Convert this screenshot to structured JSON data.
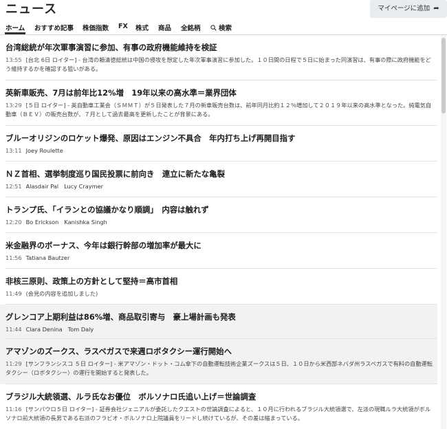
{
  "header": {
    "title": "ニュース",
    "mypage_button": "マイページに追加",
    "mypage_icon": "share-arrow-icon"
  },
  "nav": {
    "tabs": [
      {
        "label": "ホーム",
        "active": true
      },
      {
        "label": "おすすめ記事"
      },
      {
        "label": "株価指数"
      },
      {
        "label": "FX"
      },
      {
        "label": "株式"
      },
      {
        "label": "商品"
      },
      {
        "label": "全銘柄"
      },
      {
        "label": "検索",
        "icon": "search-icon"
      }
    ]
  },
  "articles": [
    {
      "headline": "台湾総統が年次軍事演習に参加、有事の政府機能維持を検証",
      "time": "13:55",
      "summary": "[台北 6日 ロイター] - 台湾の頼清徳総統は中国の侵攻を想定した年次軍事演習に参加した。１０日間の日程で５日に始まった同演習は、有事の際に政府機能をどう維持するかを確認する狙いがある。"
    },
    {
      "headline": "英新車販売、7月は前年比12%増　19年以来の高水準＝業界団体",
      "time": "13:29",
      "summary": "[５日 ロイター] - 英自動車工業会（ＳＭＭＴ）が５日発表した７月の新車販売台数は、前年同月比約１２％増加して２０１９年以来の高水準となった。純電気自動車（ＢＥＶ）の販売台数が、７月として過去最高を更新したことが背景にある。"
    },
    {
      "headline": "ブルーオリジンのロケット爆発、原因はエンジン不具合　年内打ち上げ再開目指す",
      "time": "13:11",
      "authors": [
        "Joey Roulette"
      ]
    },
    {
      "headline": "ＮＺ首相、選挙制度巡り国民投票に前向き　連立に新たな亀裂",
      "time": "12:51",
      "authors": [
        "Alasdair Pal",
        "Lucy Craymer"
      ]
    },
    {
      "headline": "トランプ氏、「イランとの協議かなり順調」　内容は触れず",
      "time": "12:20",
      "authors": [
        "Bo Erickson",
        "Kanishka Singh"
      ]
    },
    {
      "headline": "米金融界のボーナス、今年は銀行幹部の増加率が最大に",
      "time": "11:56",
      "authors": [
        "Tatiana Bautzer"
      ]
    },
    {
      "headline": "非核三原則、政策上の方針として堅持＝高市首相",
      "time": "11:49",
      "summary": "(会見の内容を追加しました)"
    },
    {
      "headline": "グレンコア上期利益は86%増、商品取引寄与　豪上場計画も発表",
      "time": "11:44",
      "authors": [
        "Clara Denina",
        "Tom Daly"
      ],
      "shaded": true
    },
    {
      "headline": "アマゾンのズークス、ラスベガスで来週ロボタクシー運行開始へ",
      "time": "11:29",
      "summary": "[サンフランシスコ ５日 ロイター] - 米アマゾン・ドット・コム傘下の自動運転技術企業ズークスは５日、１０日から米西部ネバダ州ラスベガスで有料の自動運転タクシー（ロボタクシー）の運行を開始すると発表した。",
      "shaded": true
    },
    {
      "headline": "ブラジル大統領選、ルラ氏なお優位　ボルソナロ氏追い上げ＝世論調査",
      "time": "11:16",
      "summary": "[サンパウロ５日 ロイター] - 証券会社ジェニアルが委託したクエストの世論調査によると、１０月に行われるブラジル大統領選で、左派の現職ルラ大統領がボルソナロ前大統領の長男である右派のフラビオ・ボルソナロ上院議員をリードし続けているが、その差は縮まっている。"
    }
  ]
}
